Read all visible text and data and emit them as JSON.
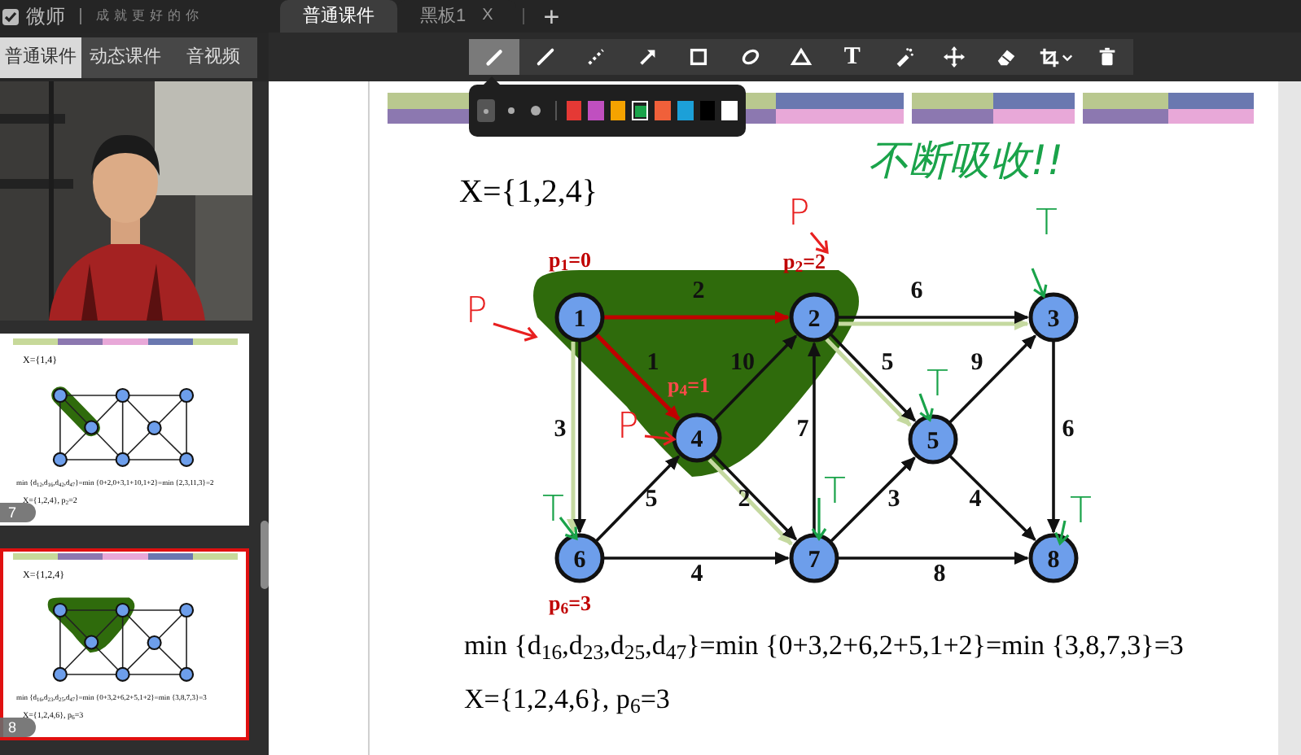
{
  "app": {
    "logo": "微师",
    "slogan": "成就更好的你"
  },
  "doc_tabs": [
    {
      "label": "普通课件",
      "selected": true
    },
    {
      "label": "黑板1",
      "selected": false,
      "close": "X"
    }
  ],
  "new_tab": "+",
  "panel_tabs": [
    {
      "label": "普通课件",
      "selected": true
    },
    {
      "label": "动态课件",
      "selected": false
    },
    {
      "label": "音视频",
      "selected": false
    }
  ],
  "tools": [
    {
      "kind": "pencil",
      "selected": true
    },
    {
      "kind": "line",
      "selected": false
    },
    {
      "kind": "dashed",
      "selected": false
    },
    {
      "kind": "arrow",
      "selected": false
    },
    {
      "kind": "rectangle",
      "selected": false
    },
    {
      "kind": "ellipse",
      "selected": false
    },
    {
      "kind": "triangle",
      "selected": false
    },
    {
      "kind": "text",
      "label": "T",
      "selected": false
    },
    {
      "kind": "spray",
      "selected": false
    },
    {
      "kind": "move",
      "selected": false
    },
    {
      "kind": "eraser",
      "selected": false
    },
    {
      "kind": "crop",
      "selected": false
    },
    {
      "kind": "trash",
      "selected": false
    }
  ],
  "pen_sizes": [
    {
      "selected": true
    },
    {
      "selected": false
    },
    {
      "selected": false
    }
  ],
  "colors": [
    {
      "color": "#e53935",
      "selected": false
    },
    {
      "color": "#c04fc0",
      "selected": false
    },
    {
      "color": "#f5a300",
      "selected": false
    },
    {
      "color": "#1aa34a",
      "selected": true
    },
    {
      "color": "#f0603a",
      "selected": false
    },
    {
      "color": "#1ca0d8",
      "selected": false
    },
    {
      "color": "#000000",
      "selected": false
    },
    {
      "color": "#ffffff",
      "selected": false
    }
  ],
  "thumbnails": [
    {
      "page": "7",
      "selected": false,
      "title": "X={1,4}",
      "formula": "min {d$_{12}$,d$_{16}$,d$_{42}$,d$_{47}$}=min {0+2,0+3,1+10,1+2}=min {2,3,11,3}=2",
      "result": "X={1,2,4}, p$_{2}$=2"
    },
    {
      "page": "8",
      "selected": true,
      "title": "X={1,2,4}",
      "formula": "min {d$_{16}$,d$_{23}$,d$_{25}$,d$_{47}$}=min {0+3,2+6,2+5,1+2}=min {3,8,7,3}=3",
      "result": "X={1,2,4,6}, p$_{6}$=3"
    }
  ],
  "slide": {
    "title": "X={1,2,4}",
    "nodes": [
      "1",
      "2",
      "3",
      "4",
      "5",
      "6",
      "7",
      "8"
    ],
    "edges": [
      {
        "weight": "2",
        "kind": "red"
      },
      {
        "weight": "1",
        "kind": "red"
      },
      {
        "weight": "3",
        "kind": "traced"
      },
      {
        "weight": "10",
        "kind": "plain"
      },
      {
        "weight": "6",
        "kind": "traced"
      },
      {
        "weight": "5",
        "kind": "traced"
      },
      {
        "weight": "9",
        "kind": "plain"
      },
      {
        "weight": "6",
        "kind": "plain"
      },
      {
        "weight": "5",
        "kind": "plain"
      },
      {
        "weight": "2",
        "kind": "traced"
      },
      {
        "weight": "7",
        "kind": "plain"
      },
      {
        "weight": "3",
        "kind": "plain"
      },
      {
        "weight": "4",
        "kind": "plain"
      },
      {
        "weight": "4",
        "kind": "plain"
      },
      {
        "weight": "8",
        "kind": "plain"
      }
    ],
    "p_labels": [
      "p$_{1}$=0",
      "p$_{2}$=2",
      "p$_{4}$=1",
      "p$_{6}$=3"
    ],
    "formula": "min {d$_{16}$,d$_{23}$,d$_{25}$,d$_{47}$}=min {0+3,2+6,2+5,1+2}=min {3,8,7,3}=3",
    "result": "X={1,2,4,6}, p$_{6}$=3",
    "annotations": [
      {
        "kind": "note",
        "text": "不断吸收!!",
        "color": "#1aa34a"
      },
      {
        "kind": "pointer",
        "text": "P",
        "color": "#e82020"
      },
      {
        "kind": "pointer",
        "text": "P",
        "color": "#e82020"
      },
      {
        "kind": "pointer",
        "text": "P",
        "color": "#e82020"
      },
      {
        "kind": "pointer",
        "text": "T",
        "color": "#1aa34a"
      },
      {
        "kind": "pointer",
        "text": "T",
        "color": "#1aa34a"
      },
      {
        "kind": "pointer",
        "text": "T",
        "color": "#1aa34a"
      },
      {
        "kind": "pointer",
        "text": "T",
        "color": "#1aa34a"
      },
      {
        "kind": "pointer",
        "text": "T",
        "color": "#1aa34a"
      }
    ]
  }
}
